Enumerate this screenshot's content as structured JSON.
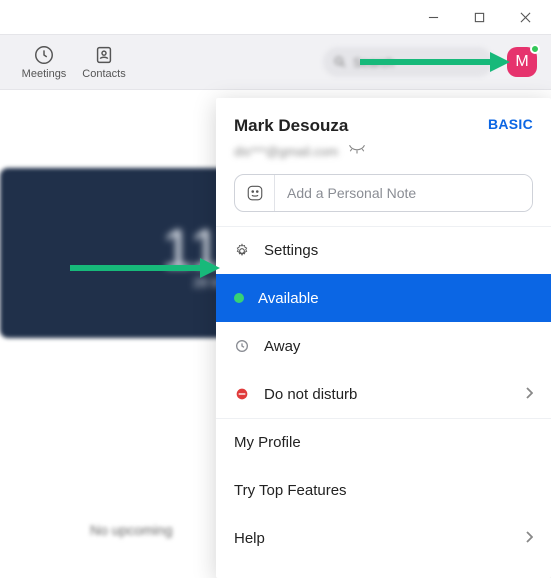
{
  "toolbar": {
    "meetings_label": "Meetings",
    "contacts_label": "Contacts",
    "search_placeholder": "Search"
  },
  "avatar": {
    "initial": "M"
  },
  "background": {
    "time": "11",
    "date": "28 M",
    "no_upcoming": "No upcoming"
  },
  "profile": {
    "name": "Mark Desouza",
    "plan": "BASIC",
    "email_masked": "dis***@gmail.com",
    "note_placeholder": "Add a Personal Note"
  },
  "menu": {
    "settings": "Settings",
    "available": "Available",
    "away": "Away",
    "dnd": "Do not disturb",
    "my_profile": "My Profile",
    "top_features": "Try Top Features",
    "help": "Help"
  }
}
